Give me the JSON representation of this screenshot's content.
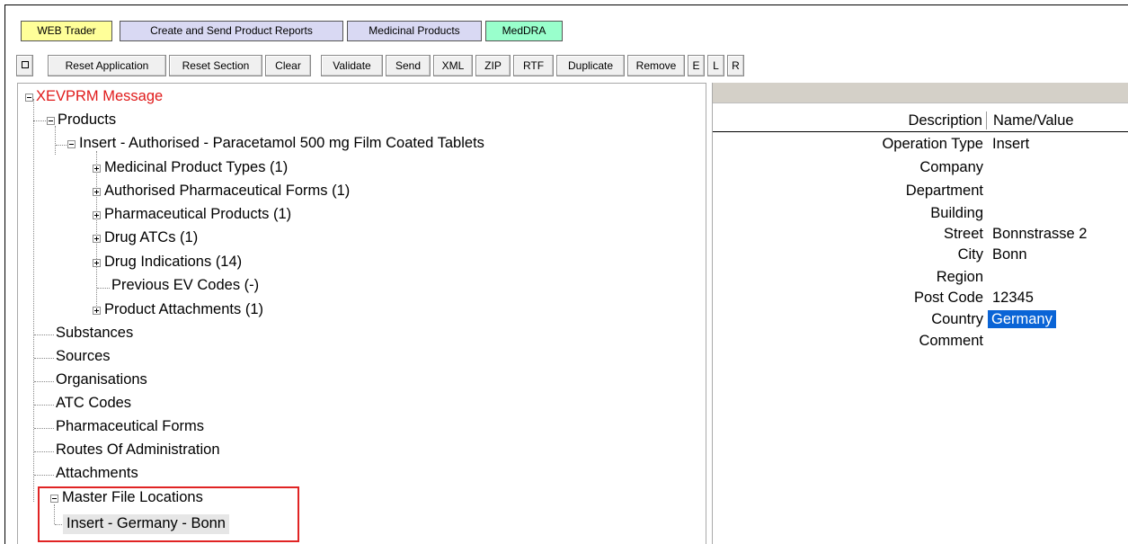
{
  "tabs": [
    {
      "label": "WEB Trader",
      "bg": "#ffff99"
    },
    {
      "label": "Create and Send Product Reports",
      "bg": "#d9d9f3"
    },
    {
      "label": "Medicinal Products",
      "bg": "#d9d9f3"
    },
    {
      "label": "MedDRA",
      "bg": "#99ffcc"
    }
  ],
  "toolbar": {
    "icon": "square-icon",
    "reset_application": "Reset Application",
    "reset_section": "Reset Section",
    "clear": "Clear",
    "validate": "Validate",
    "send": "Send",
    "xml": "XML",
    "zip": "ZIP",
    "rtf": "RTF",
    "duplicate": "Duplicate",
    "remove": "Remove",
    "e": "E",
    "l": "L",
    "r": "R"
  },
  "tree": {
    "root": "XEVPRM Message",
    "products": "Products",
    "insert_product": "Insert - Authorised - Paracetamol 500 mg Film Coated Tablets",
    "product_children": [
      "Medicinal Product Types (1)",
      "Authorised Pharmaceutical Forms (1)",
      "Pharmaceutical Products (1)",
      "Drug ATCs (1)",
      "Drug Indications (14)",
      "Previous EV Codes (-)",
      "Product Attachments (1)"
    ],
    "sections": [
      "Substances",
      "Sources",
      "Organisations",
      "ATC Codes",
      "Pharmaceutical Forms",
      "Routes Of Administration",
      "Attachments"
    ],
    "master_file_locations": "Master File Locations",
    "master_file_item": "Insert - Germany - Bonn"
  },
  "details": {
    "header_description": "Description",
    "header_value": "Name/Value",
    "rows": [
      {
        "label": "Operation Type",
        "value": "Insert"
      },
      {
        "label": "Company",
        "value": ""
      },
      {
        "label": "Department",
        "value": ""
      },
      {
        "label": "Building",
        "value": ""
      },
      {
        "label": "Street",
        "value": "Bonnstrasse 2"
      },
      {
        "label": "City",
        "value": "Bonn"
      },
      {
        "label": "Region",
        "value": ""
      },
      {
        "label": "Post Code",
        "value": "12345"
      },
      {
        "label": "Country",
        "value": "Germany"
      },
      {
        "label": "Comment",
        "value": ""
      }
    ]
  },
  "colors": {
    "root_text": "#e01b1b",
    "highlight_border": "#e02424",
    "selection": "#0a64d6"
  }
}
